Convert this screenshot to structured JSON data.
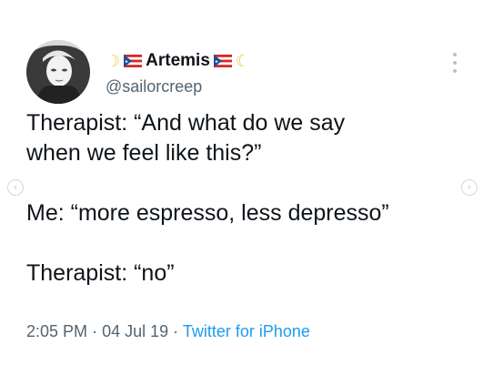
{
  "user": {
    "name": "Artemis",
    "handle": "@sailorcreep",
    "name_decor_icons": [
      "crescent-moon-icon",
      "puerto-rico-flag-icon"
    ]
  },
  "tweet": {
    "lines": [
      "Therapist: “And what do we say",
      "when we feel like this?”",
      "Me: “more espresso, less depresso”",
      "Therapist: “no”"
    ]
  },
  "meta": {
    "time": "2:05 PM",
    "date": "04 Jul 19",
    "separator": "·",
    "source": "Twitter for iPhone"
  },
  "controls": {
    "more_icon": "more-vertical-icon",
    "prev_icon": "chevron-left-icon",
    "next_icon": "chevron-right-icon",
    "prev_glyph": "‹",
    "next_glyph": "›"
  },
  "colors": {
    "text": "#0f1419",
    "secondary": "#536471",
    "link": "#1d9bf0",
    "moon": "#f2c94c"
  }
}
